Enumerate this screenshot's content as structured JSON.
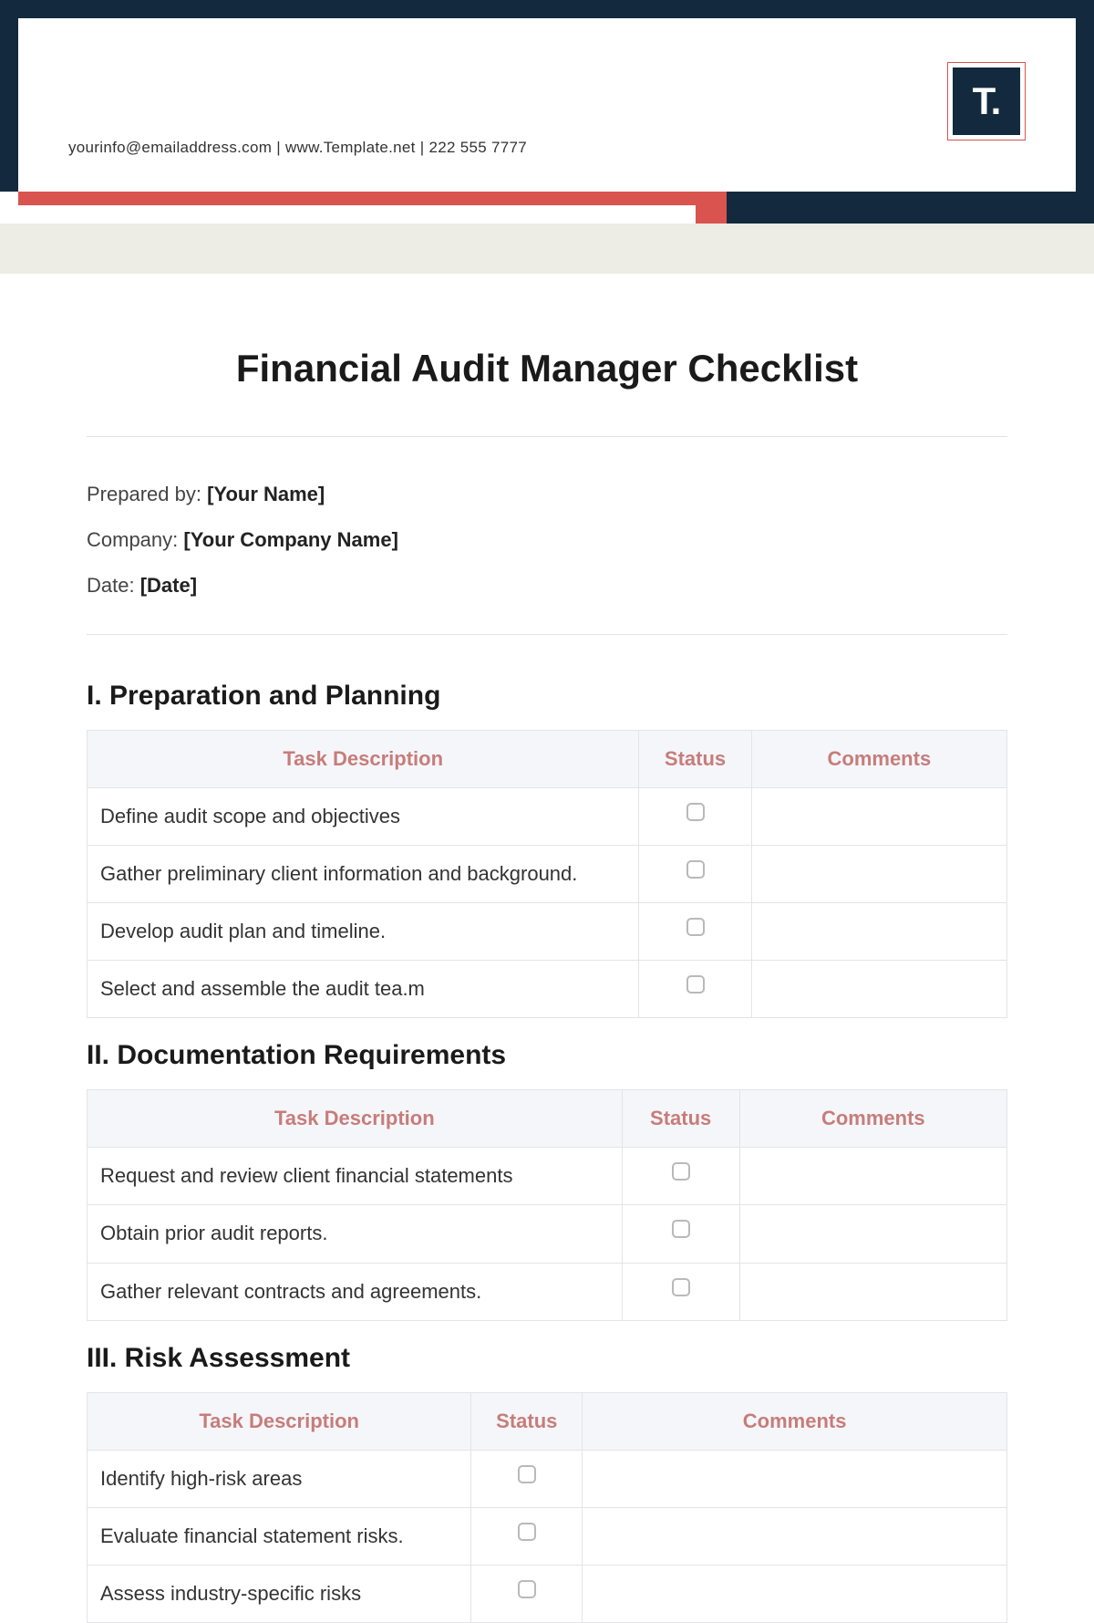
{
  "header": {
    "contact_line": "yourinfo@emailaddress.com  |  www.Template.net  |  222 555 7777",
    "logo_text": "T."
  },
  "doc_title": "Financial Audit Manager Checklist",
  "meta": {
    "prepared_by_label": "Prepared by: ",
    "prepared_by_value": "[Your Name]",
    "company_label": "Company: ",
    "company_value": "[Your Company Name]",
    "date_label": "Date: ",
    "date_value": "[Date]"
  },
  "columns": {
    "task": "Task Description",
    "status": "Status",
    "comments": "Comments"
  },
  "sections": [
    {
      "heading": "I. Preparation and Planning",
      "rows": [
        {
          "task": "Define audit scope and objectives",
          "comments": ""
        },
        {
          "task": "Gather preliminary client information and background.",
          "comments": ""
        },
        {
          "task": "Develop audit plan and timeline.",
          "comments": ""
        },
        {
          "task": "Select and assemble the audit tea.m",
          "comments": ""
        }
      ]
    },
    {
      "heading": "II. Documentation Requirements",
      "rows": [
        {
          "task": "Request and review client financial statements",
          "comments": ""
        },
        {
          "task": "Obtain prior audit reports.",
          "comments": ""
        },
        {
          "task": "Gather relevant contracts and agreements.",
          "comments": ""
        }
      ]
    },
    {
      "heading": "III. Risk Assessment",
      "rows": [
        {
          "task": "Identify high-risk areas",
          "comments": ""
        },
        {
          "task": "Evaluate financial statement risks.",
          "comments": ""
        },
        {
          "task": "Assess industry-specific risks",
          "comments": ""
        }
      ]
    }
  ]
}
